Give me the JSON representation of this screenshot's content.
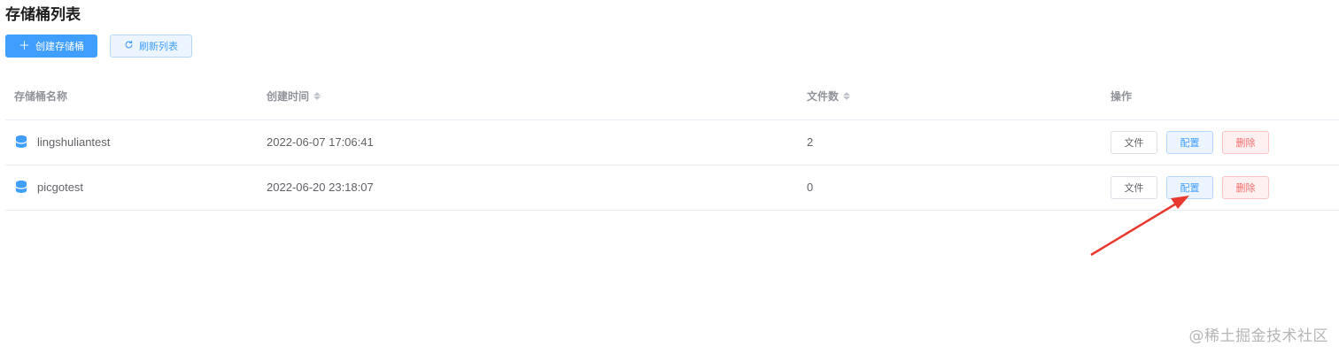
{
  "page": {
    "title": "存储桶列表"
  },
  "toolbar": {
    "create_label": "创建存储桶",
    "create_icon": "plus-icon",
    "refresh_label": "刷新列表",
    "refresh_icon": "refresh-icon"
  },
  "table": {
    "columns": [
      "存储桶名称",
      "创建时间",
      "文件数",
      "操作"
    ],
    "rows": [
      {
        "name": "lingshuliantest",
        "created": "2022-06-07 17:06:41",
        "files": "2",
        "actions": [
          "文件",
          "配置",
          "删除"
        ]
      },
      {
        "name": "picgotest",
        "created": "2022-06-20 23:18:07",
        "files": "0",
        "actions": [
          "文件",
          "配置",
          "删除"
        ]
      }
    ]
  },
  "colors": {
    "primary": "#409eff",
    "danger": "#f56c6c",
    "annotation_arrow": "#e8392f"
  },
  "watermark": "@稀土掘金技术社区"
}
